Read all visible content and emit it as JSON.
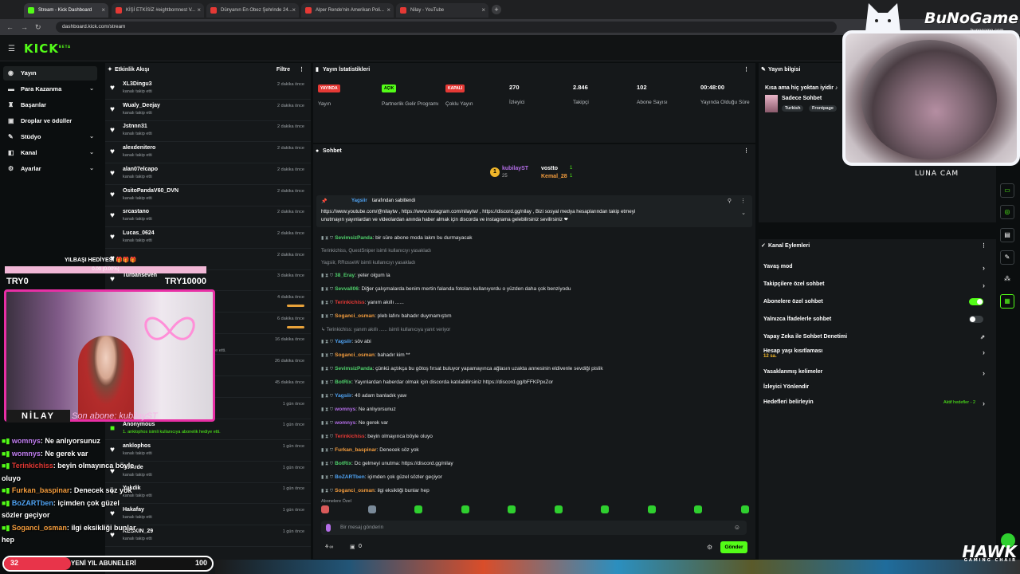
{
  "browser": {
    "tabs": [
      {
        "label": "Stream - Kick Dashboard",
        "active": true,
        "color": "#53fc18"
      },
      {
        "label": "KİŞİ ETKİSİZ #eightbornnest V...",
        "active": false,
        "color": "#e53935"
      },
      {
        "label": "Dünyanın En Obez Şehrinde 24...",
        "active": false,
        "color": "#e53935"
      },
      {
        "label": "Alper Rende'nin Amerikan Poli...",
        "active": false,
        "color": "#e53935"
      },
      {
        "label": "Nilay - YouTube",
        "active": false,
        "color": "#e53935"
      }
    ],
    "url": "dashboard.kick.com/stream"
  },
  "kick": {
    "logo": "KICK",
    "logo_tag": "BETA"
  },
  "sidebar": {
    "items": [
      {
        "label": "Yayın",
        "icon": "broadcast-icon",
        "active": true,
        "chevron": false
      },
      {
        "label": "Para Kazanma",
        "icon": "money-icon",
        "active": false,
        "chevron": true
      },
      {
        "label": "Başarılar",
        "icon": "trophy-icon",
        "active": false,
        "chevron": false
      },
      {
        "label": "Droplar ve ödüller",
        "icon": "gift-icon",
        "active": false,
        "chevron": false
      },
      {
        "label": "Stüdyo",
        "icon": "studio-icon",
        "active": false,
        "chevron": true
      },
      {
        "label": "Kanal",
        "icon": "channel-icon",
        "active": false,
        "chevron": true
      },
      {
        "label": "Ayarlar",
        "icon": "settings-icon",
        "active": false,
        "chevron": true
      }
    ]
  },
  "activity": {
    "title": "Etkinlik Akışı",
    "filter": "Filtre",
    "rows": [
      {
        "name": "XL3Dingu3",
        "sub": "kanalı takip etti",
        "time": "2 dakika önce"
      },
      {
        "name": "Wualy_Deejay",
        "sub": "kanalı takip etti",
        "time": "2 dakika önce"
      },
      {
        "name": "Jstnnn31",
        "sub": "kanalı takip etti",
        "time": "2 dakika önce"
      },
      {
        "name": "alexdenitero",
        "sub": "kanalı takip etti",
        "time": "2 dakika önce"
      },
      {
        "name": "alan07elcapo",
        "sub": "kanalı takip etti",
        "time": "2 dakika önce"
      },
      {
        "name": "OsitoPandaV60_DVN",
        "sub": "kanalı takip etti",
        "time": "2 dakika önce"
      },
      {
        "name": "srcastano",
        "sub": "kanalı takip etti",
        "time": "2 dakika önce"
      },
      {
        "name": "Lucas_0624",
        "sub": "kanalı takip etti",
        "time": "2 dakika önce"
      },
      {
        "name": "",
        "sub": "",
        "time": "2 dakika önce"
      },
      {
        "name": "Turbanseven",
        "sub": "",
        "time": "3 dakika önce"
      },
      {
        "name": "",
        "sub": "",
        "time": "4 dakika önce"
      },
      {
        "name": "",
        "sub": "",
        "time": "6 dakika önce"
      },
      {
        "name": "",
        "sub": "",
        "time": "16 dakika önce"
      },
      {
        "name": "",
        "sub": "",
        "time": "26 dakika önce"
      },
      {
        "name": "",
        "sub": "",
        "time": "45 dakika önce"
      },
      {
        "name": "",
        "sub": "",
        "time": "1 gün önce"
      },
      {
        "name": "Anonymous",
        "sub": "1. anklophos isimli kullanıcıya abonelik hediye etti.",
        "time": "1 gün önce"
      },
      {
        "name": "anklophos",
        "sub": "kanalı takip etti",
        "time": "1 gün önce"
      },
      {
        "name": "Aclarde",
        "sub": "kanalı takip etti",
        "time": "1 gün önce"
      },
      {
        "name": "Yukdik",
        "sub": "kanalı takip etti",
        "time": "1 gün önce"
      },
      {
        "name": "Hakafay",
        "sub": "kanalı takip etti",
        "time": "1 gün önce"
      },
      {
        "name": "KESKIN_29",
        "sub": "kanalı takip etti",
        "time": "1 gün önce"
      }
    ],
    "gift_text": "hediye etti."
  },
  "stats": {
    "title": "Yayın İstatistikleri",
    "items": [
      {
        "badge": "YAYINDA",
        "badge_color": "#e53935",
        "label": "Yayın"
      },
      {
        "badge": "AÇIK",
        "badge_color": "#53fc18",
        "label": "Partnerlik Gelir Programı"
      },
      {
        "badge": "KAPALI",
        "badge_color": "#e53935",
        "label": "Çoklu Yayın"
      },
      {
        "value": "270",
        "label": "İzleyici"
      },
      {
        "value": "2.846",
        "label": "Takipçi"
      },
      {
        "value": "102",
        "label": "Abone Sayısı"
      },
      {
        "value": "00:48:00",
        "label": "Yayında Olduğu Süre"
      }
    ]
  },
  "chat": {
    "title": "Sohbet",
    "leaders": {
      "first": "kubilayST",
      "first_count": "25",
      "second": "vostto",
      "second_count": "1",
      "third": "Kemal_28",
      "third_count": "1"
    },
    "pinned_by": "Yagsiir",
    "pinned_suffix": "tarafından sabitlendi",
    "pinned_text_1": "https://www.youtube.com/@nilaytw , https://www.instagram.com/nilaytw/ , https://discord.gg/nilay , Bizi sosyal medya hesaplarından takip etmeyi",
    "pinned_text_2": "unutmayın yayınlardan ve videolardan anında haber almak için discorda ve instagrama gelebilirsiniz sevilirsiniz ❤",
    "messages": [
      {
        "user": "SevimsizPanda",
        "color": "#4fd16b",
        "text": "bir süre abone moda lakm bu durmayacak"
      },
      {
        "system": "Terinkichiss, QuestSniper isimli kullanıcıyı yasakladı"
      },
      {
        "system": "Yagsiir, RRosseW isimli kullanıcıyı yasakladı"
      },
      {
        "user": "38_Eray",
        "color": "#4fd16b",
        "text": "yeter olgum la"
      },
      {
        "user": "Sevvall06",
        "color": "#4fd16b",
        "text": "Diğer çalışmalarda benim mertin falanda fotoları kullanıyordu o yüzden daha çok benziyodu"
      },
      {
        "user": "Terinkichiss",
        "color": "#e53935",
        "text": "yanım akıllı ......"
      },
      {
        "user": "Soganci_osman",
        "color": "#f39c3d",
        "text": "pleb lafını bahadır duymamıştım"
      },
      {
        "system": "↳ Terinkichiss: yanım akıllı ...... isimli kullanıcıya yanıt veriyor"
      },
      {
        "user": "Yagsiir",
        "color": "#4fa3f3",
        "text": "söv abi"
      },
      {
        "user": "Soganci_osman",
        "color": "#f39c3d",
        "text": "bahadır kim **"
      },
      {
        "user": "SevimsizPanda",
        "color": "#4fd16b",
        "text": "çünkü açtıkça bu götoş fırsat buluyor yapamayınca ağlasın uzakta annesinin eldivenle sevdiği pislik"
      },
      {
        "user": "BotRix",
        "color": "#4fd16b",
        "text": "Yayınlardan haberdar olmak için discorda katılabilirsiniz https://discord.gg/bFFKPpxZor"
      },
      {
        "user": "Yagsiir",
        "color": "#4fa3f3",
        "text": "40 adam banladık yaw"
      },
      {
        "user": "womnys",
        "color": "#b46ee8",
        "text": "Ne anlıyorsunuz"
      },
      {
        "user": "womnys",
        "color": "#b46ee8",
        "text": "Ne gerek var"
      },
      {
        "user": "Terinkichiss",
        "color": "#e53935",
        "text": "beyin olmayınca böyle oluyo"
      },
      {
        "user": "Furkan_baspinar",
        "color": "#f39c3d",
        "text": "Denecek söz yok"
      },
      {
        "user": "BotRix",
        "color": "#4fd16b",
        "text": "Dc gelmeyi unutma: https://discord.gg/nilay"
      },
      {
        "user": "BoZARTben",
        "color": "#4fa3f3",
        "text": "içimden çok güzel sözler geçiyor"
      },
      {
        "user": "Soganci_osman",
        "color": "#f39c3d",
        "text": "ilgi eksikliği bunlar hep"
      }
    ],
    "emotes_label": "Abonelere Özel",
    "input_placeholder": "Bir mesaj gönderin",
    "counter": "0",
    "send_label": "Gönder"
  },
  "info": {
    "title": "Yayın bilgisi",
    "stream_title": "Kısa ama hiç yoktan iyidir ♪",
    "category": "Sadece Sohbet",
    "tags": [
      "Turkish",
      "Frontpage"
    ]
  },
  "actions": {
    "title": "Kanal Eylemleri",
    "rows": [
      {
        "label": "Yavaş mod",
        "type": "chevron"
      },
      {
        "label": "Takipçilere özel sohbet",
        "type": "chevron"
      },
      {
        "label": "Abonelere özel sohbet",
        "type": "toggle",
        "on": true
      },
      {
        "label": "Yalnızca İfadelerle sohbet",
        "type": "toggle",
        "on": false
      },
      {
        "label": "Yapay Zeka ile Sohbet Denetimi",
        "type": "ext"
      },
      {
        "label": "Hesap yaşı kısıtlaması",
        "sub": "12 sa.",
        "type": "chevron"
      },
      {
        "label": "Yasaklanmış kelimeler",
        "type": "chevron"
      },
      {
        "label": "İzleyici Yönlendir",
        "type": "none"
      },
      {
        "label": "Hedefleri belirleyin",
        "type": "chevron",
        "note": "Aktif hedefler - 2"
      }
    ]
  },
  "overlay": {
    "brand": "BuNoGame",
    "brand_url": "bunogame.com",
    "cat_label": "LUNA CAM",
    "gift_title": "YILBAŞI HEDİYESİ 🎁🎁🎁",
    "gift_progress": "0.00 (0.00%)",
    "gift_left": "TRY0",
    "gift_right": "TRY10000",
    "name": "NİLAY",
    "last_sub": "Son abone: kubilayST",
    "chat_lines": [
      {
        "user": "womnys",
        "color": "#c07ef0",
        "text": ": Ne anlıyorsunuz"
      },
      {
        "user": "womnys",
        "color": "#c07ef0",
        "text": ": Ne gerek var"
      },
      {
        "user": "Terinkichiss",
        "color": "#e53935",
        "text": ": beyin olmayınca böyle"
      },
      {
        "user": "",
        "color": "#fff",
        "text": "oluyo"
      },
      {
        "user": "Furkan_baspinar",
        "color": "#f39c3d",
        "text": ": Denecek söz yok"
      },
      {
        "user": "BoZARTben",
        "color": "#4fa3f3",
        "text": ": içimden çok güzel"
      },
      {
        "user": "",
        "color": "#fff",
        "text": "sözler geçiyor"
      },
      {
        "user": "Soganci_osman",
        "color": "#f39c3d",
        "text": ": ilgi eksikliği bunlar"
      },
      {
        "user": "",
        "color": "#fff",
        "text": "hep"
      }
    ],
    "goal_left": "32",
    "goal_title": "YENİ YIL ABUNELERİ",
    "goal_right": "100",
    "goal_fraction": 0.32,
    "hawk": "HAWK",
    "hawk_sub": "GAMING CHAIR"
  }
}
